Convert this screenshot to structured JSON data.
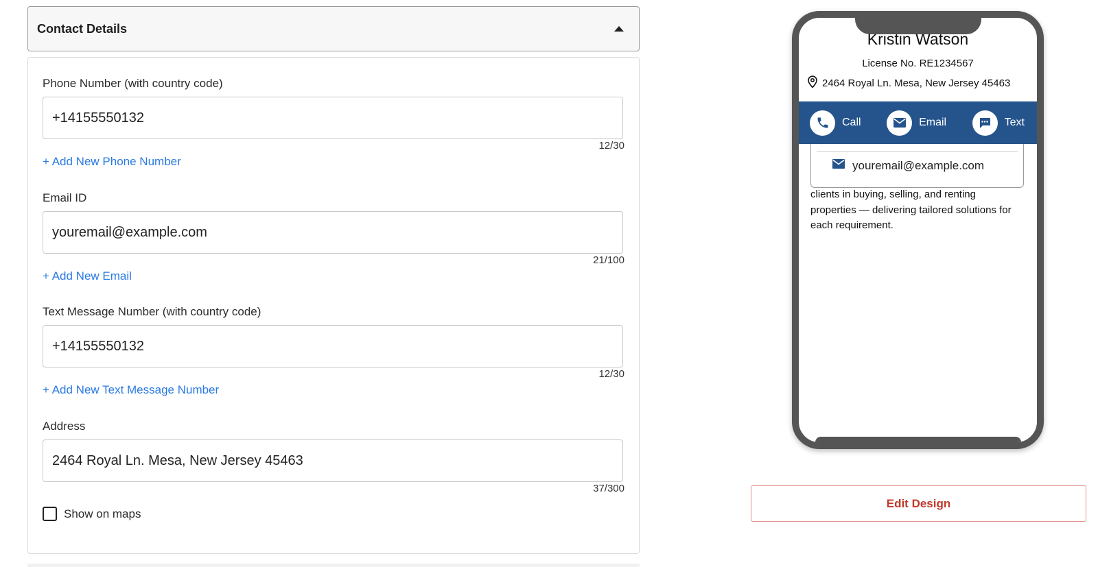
{
  "section": {
    "title": "Contact Details"
  },
  "phone": {
    "label": "Phone Number (with country code)",
    "value": "+14155550132",
    "counter": "12/30",
    "add_link": "+ Add New Phone Number"
  },
  "email": {
    "label": "Email ID",
    "value": "youremail@example.com",
    "counter": "21/100",
    "add_link": "+ Add New Email"
  },
  "text_message": {
    "label": "Text Message Number (with country code)",
    "value": "+14155550132",
    "counter": "12/30",
    "add_link": "+ Add New Text Message Number"
  },
  "address": {
    "label": "Address",
    "value": "2464 Royal Ln. Mesa, New Jersey 45463",
    "counter": "37/300",
    "show_on_maps_label": "Show on maps",
    "show_on_maps_checked": false
  },
  "preview": {
    "name": "Kristin Watson",
    "license": "License No. RE1234567",
    "address": "2464 Royal Ln. Mesa, New Jersey 45463",
    "actions": {
      "call": "Call",
      "email": "Email",
      "text": "Text"
    },
    "email_item": "youremail@example.com",
    "description": "clients in buying, selling, and renting properties — delivering tailored solutions for each requirement.",
    "accent_color": "#24548b"
  },
  "edit_design_label": "Edit Design",
  "colors": {
    "link": "#2a7ae2",
    "edit_button": "#c0392b"
  }
}
